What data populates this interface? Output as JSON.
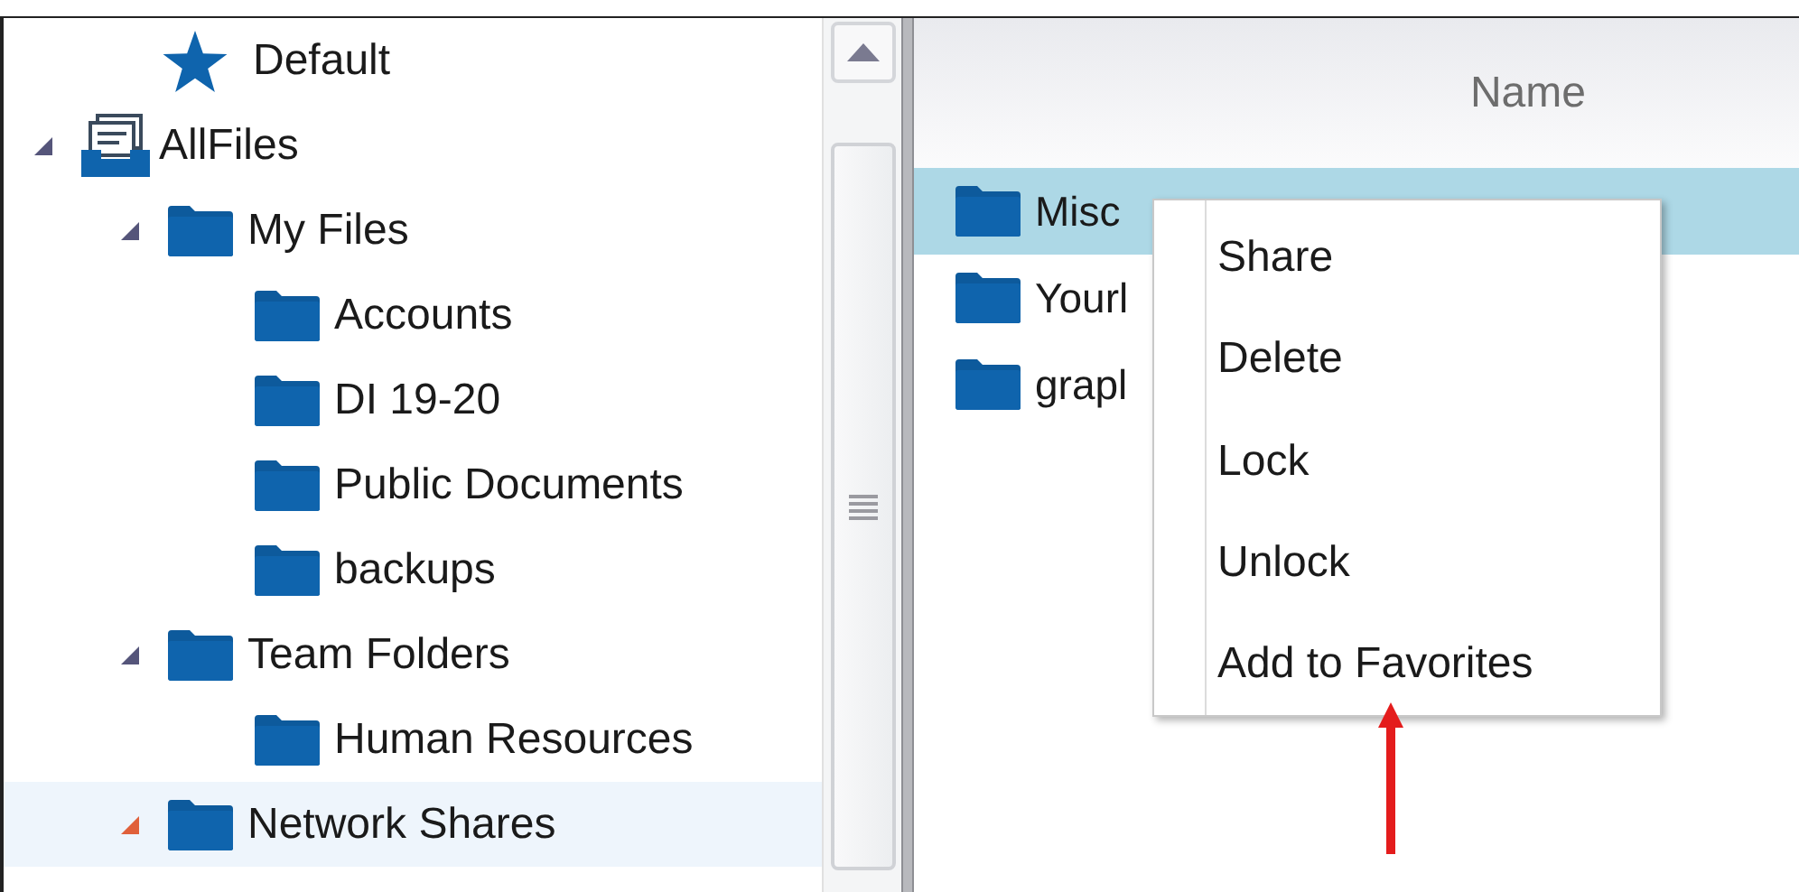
{
  "favorites": [
    {
      "label": "Default"
    }
  ],
  "tree": [
    {
      "label": "AllFiles",
      "kind": "root",
      "expanded": true,
      "selected": false,
      "children": [
        {
          "label": "My Files",
          "kind": "folder",
          "expanded": true,
          "selected": false,
          "children": [
            {
              "label": "Accounts",
              "kind": "folder",
              "selected": false
            },
            {
              "label": "DI 19-20",
              "kind": "folder",
              "selected": false
            },
            {
              "label": "Public Documents",
              "kind": "folder",
              "selected": false
            },
            {
              "label": "backups",
              "kind": "folder",
              "selected": false
            }
          ]
        },
        {
          "label": "Team Folders",
          "kind": "folder",
          "expanded": true,
          "selected": false,
          "children": [
            {
              "label": "Human Resources",
              "kind": "folder",
              "selected": false
            }
          ]
        },
        {
          "label": "Network Shares",
          "kind": "folder",
          "expanded": true,
          "selected": true
        }
      ]
    }
  ],
  "file_list": {
    "column": "Name",
    "rows": [
      {
        "name": "Misc",
        "selected": true
      },
      {
        "name": "Yourl",
        "selected": false
      },
      {
        "name": "grapl",
        "selected": false
      }
    ]
  },
  "context_menu": [
    "Share",
    "Delete",
    "Lock",
    "Unlock",
    "Add to Favorites"
  ]
}
